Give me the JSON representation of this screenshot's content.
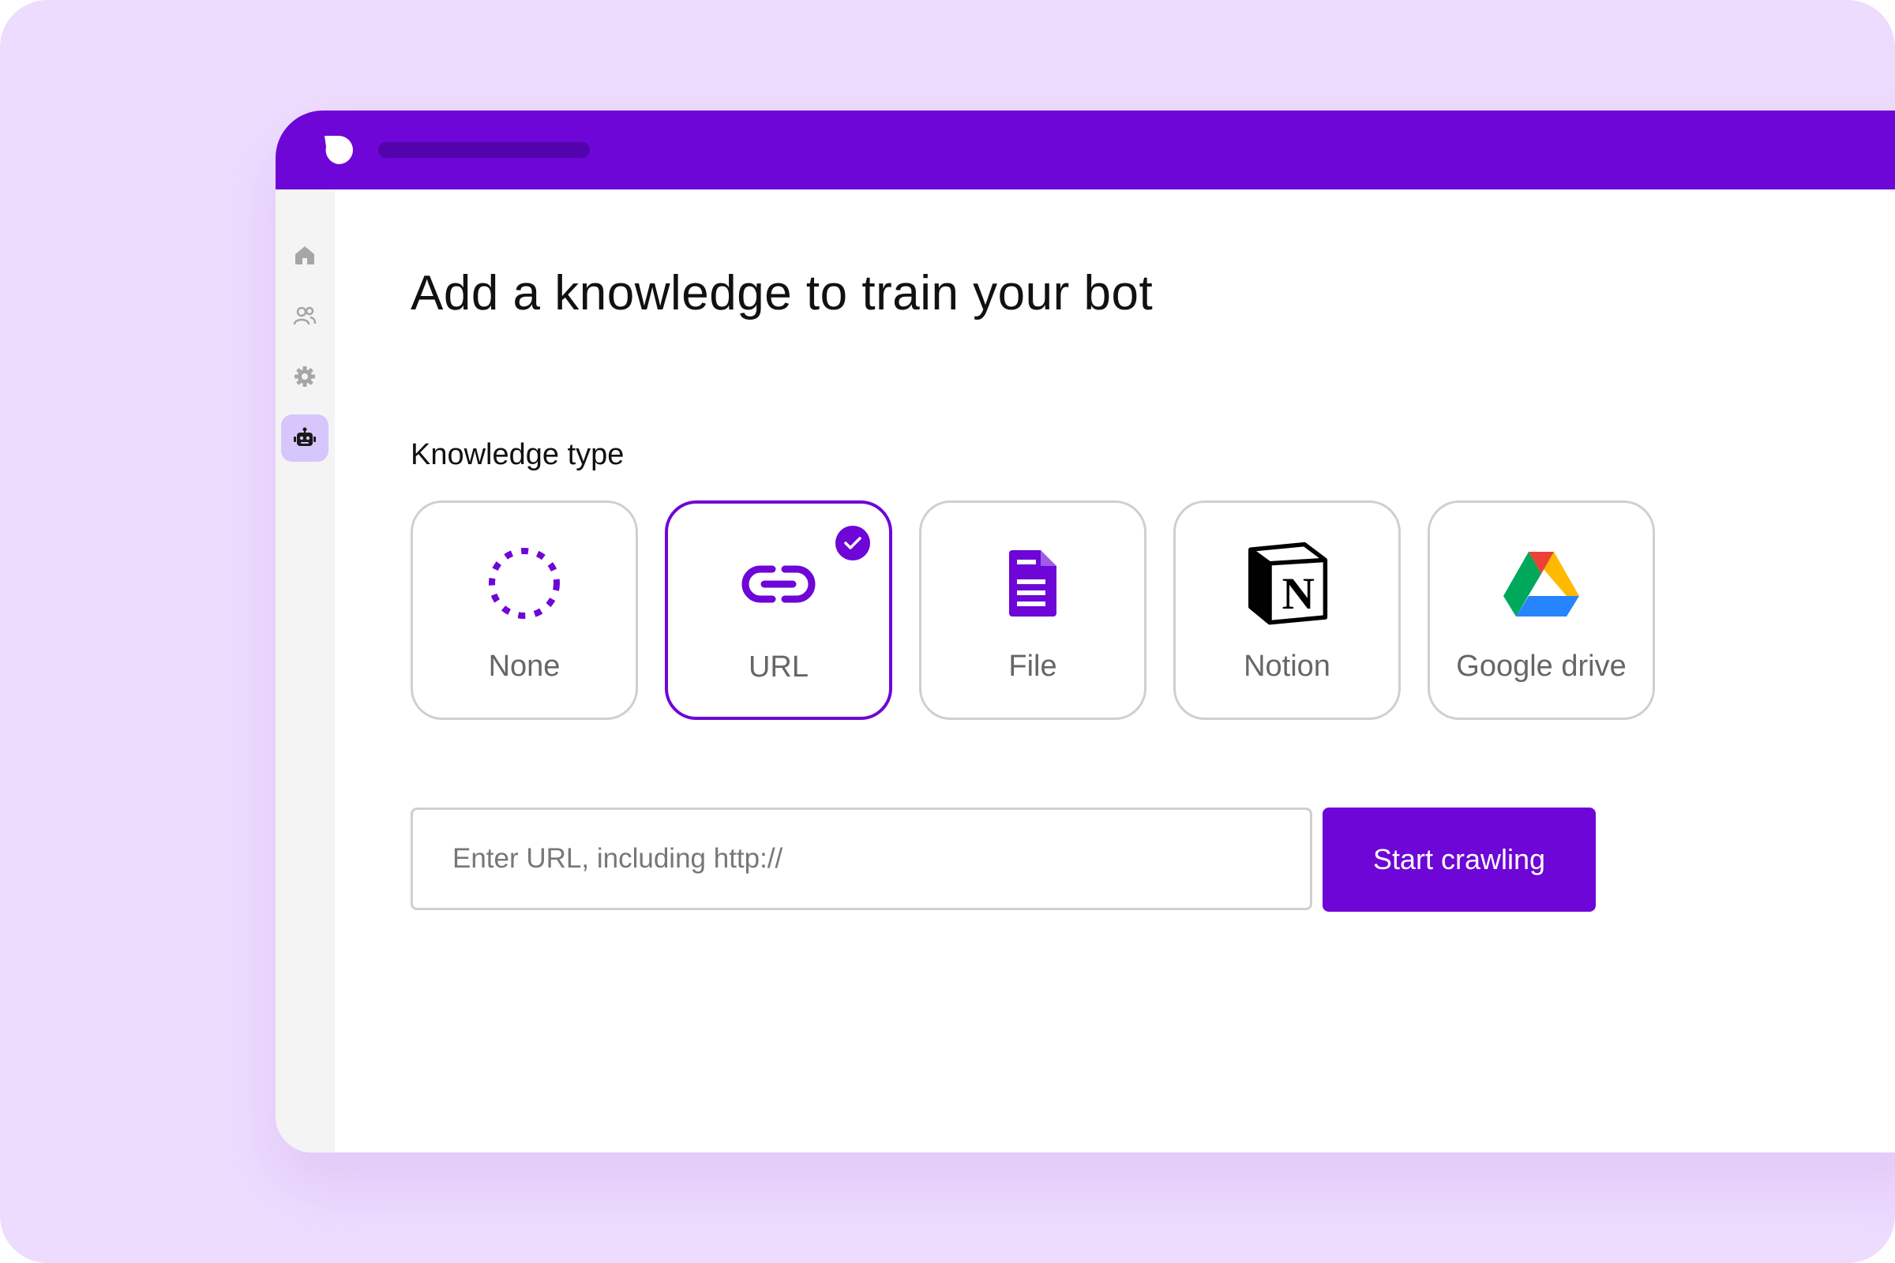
{
  "colors": {
    "accent": "#6d06d6",
    "background": "#eedcff",
    "active_nav_bg": "#d7c6fb",
    "card_border": "#cfcfcf"
  },
  "sidebar": {
    "items": [
      {
        "icon": "home-icon"
      },
      {
        "icon": "users-icon"
      },
      {
        "icon": "gear-icon"
      },
      {
        "icon": "robot-icon",
        "active": true
      }
    ]
  },
  "main": {
    "title": "Add a knowledge to train your bot",
    "section_label": "Knowledge type",
    "knowledge_types": [
      {
        "label": "None",
        "icon": "dashed-circle-icon",
        "selected": false
      },
      {
        "label": "URL",
        "icon": "link-icon",
        "selected": true
      },
      {
        "label": "File",
        "icon": "file-icon",
        "selected": false
      },
      {
        "label": "Notion",
        "icon": "notion-icon",
        "selected": false
      },
      {
        "label": "Google drive",
        "icon": "google-drive-icon",
        "selected": false
      }
    ],
    "url_input": {
      "placeholder": "Enter URL, including http://",
      "value": ""
    },
    "start_button": "Start crawling"
  }
}
